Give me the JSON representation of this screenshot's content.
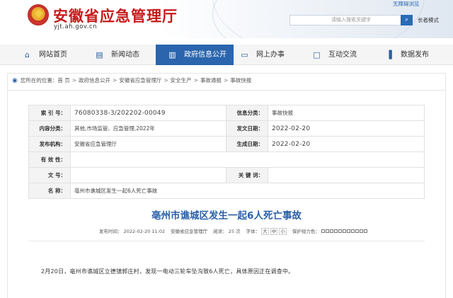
{
  "header": {
    "site_title": "安徽省应急管理厅",
    "domain": "yjt.ah.gov.cn",
    "login_label": "无障碍浏览",
    "search_placeholder": "请输入搜索关键字",
    "search_icon": "search-icon",
    "elder_mode_label": "长者模式"
  },
  "nav": {
    "items": [
      {
        "label": "网站首页",
        "icon": "home-icon"
      },
      {
        "label": "新闻动态",
        "icon": "news-icon"
      },
      {
        "label": "政府信息公开",
        "icon": "document-icon",
        "active": true
      },
      {
        "label": "网上办事",
        "icon": "monitor-icon"
      },
      {
        "label": "互动交流",
        "icon": "chat-icon"
      },
      {
        "label": "数据发布",
        "icon": "chart-icon"
      }
    ],
    "active_color": "#2a65ad"
  },
  "breadcrumb": {
    "prefix": "您所在的位置：",
    "items": [
      "首 页",
      "政府信息公开",
      "安徽省应急管理厅",
      "安全生产",
      "事故通报",
      "事故快报"
    ]
  },
  "info_table": {
    "index_label": "索 引 号：",
    "index_value": "76080338-3/202202-00049",
    "category_label": "信息分类：",
    "category_value": "事故快报",
    "topic_label": "内容分类：",
    "topic_value": "其他,市场监管、应急管理,2022年",
    "date_label": "发文日期：",
    "date_value": "2022-02-20",
    "publisher_label": "发布机构：",
    "publisher_value": "安徽省应急管理厅",
    "created_label": "生成日期：",
    "created_value": "2022-02-20",
    "validity_label": "有 效 性：",
    "validity_value": "",
    "docno_label": "文 号：",
    "docno_value": "",
    "keywords_label": "关 键 词：",
    "keywords_value": "",
    "name_label": "名 称：",
    "name_value": "亳州市谯城区发生一起6人死亡事故"
  },
  "article": {
    "title": "亳州市谯城区发生一起6人死亡事故",
    "meta_publish_label": "发布时间：",
    "meta_publish_value": "2022-02-20 11:02",
    "meta_source": "安徽省应急管理厅",
    "meta_views_label": "阅读：",
    "meta_views_value": "25 次",
    "meta_font_label": "字体：",
    "meta_font_options": [
      "大",
      "中",
      "小"
    ],
    "meta_share_label": "保护视力色：",
    "body": "2月20日，亳州市谯城区立德镇郭庄村，发现一电动三轮车坠沟致6人死亡，具体原因正在调查中。"
  }
}
